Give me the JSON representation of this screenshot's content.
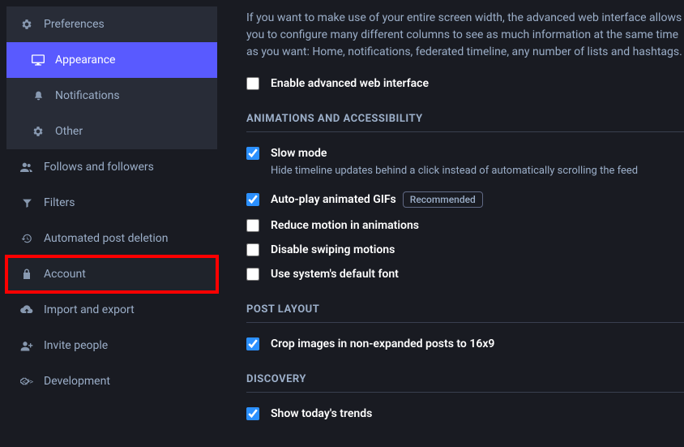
{
  "sidebar": {
    "items": [
      {
        "label": "Preferences"
      },
      {
        "label": "Appearance"
      },
      {
        "label": "Notifications"
      },
      {
        "label": "Other"
      },
      {
        "label": "Follows and followers"
      },
      {
        "label": "Filters"
      },
      {
        "label": "Automated post deletion"
      },
      {
        "label": "Account"
      },
      {
        "label": "Import and export"
      },
      {
        "label": "Invite people"
      },
      {
        "label": "Development"
      }
    ]
  },
  "intro": "If you want to make use of your entire screen width, the advanced web interface allows you to configure many different columns to see as much information at the same time as you want: Home, notifications, federated timeline, any number of lists and hashtags.",
  "settings": {
    "enable_advanced": {
      "label": "Enable advanced web interface",
      "checked": false
    }
  },
  "sections": {
    "animations": {
      "header": "ANIMATIONS AND ACCESSIBILITY",
      "slow_mode": {
        "label": "Slow mode",
        "checked": true,
        "hint": "Hide timeline updates behind a click instead of automatically scrolling the feed"
      },
      "autoplay": {
        "label": "Auto-play animated GIFs",
        "checked": true,
        "badge": "Recommended"
      },
      "reduce_motion": {
        "label": "Reduce motion in animations",
        "checked": false
      },
      "disable_swiping": {
        "label": "Disable swiping motions",
        "checked": false
      },
      "system_font": {
        "label": "Use system's default font",
        "checked": false
      }
    },
    "post_layout": {
      "header": "POST LAYOUT",
      "crop": {
        "label": "Crop images in non-expanded posts to 16x9",
        "checked": true
      }
    },
    "discovery": {
      "header": "DISCOVERY",
      "trends": {
        "label": "Show today's trends",
        "checked": true
      }
    }
  }
}
